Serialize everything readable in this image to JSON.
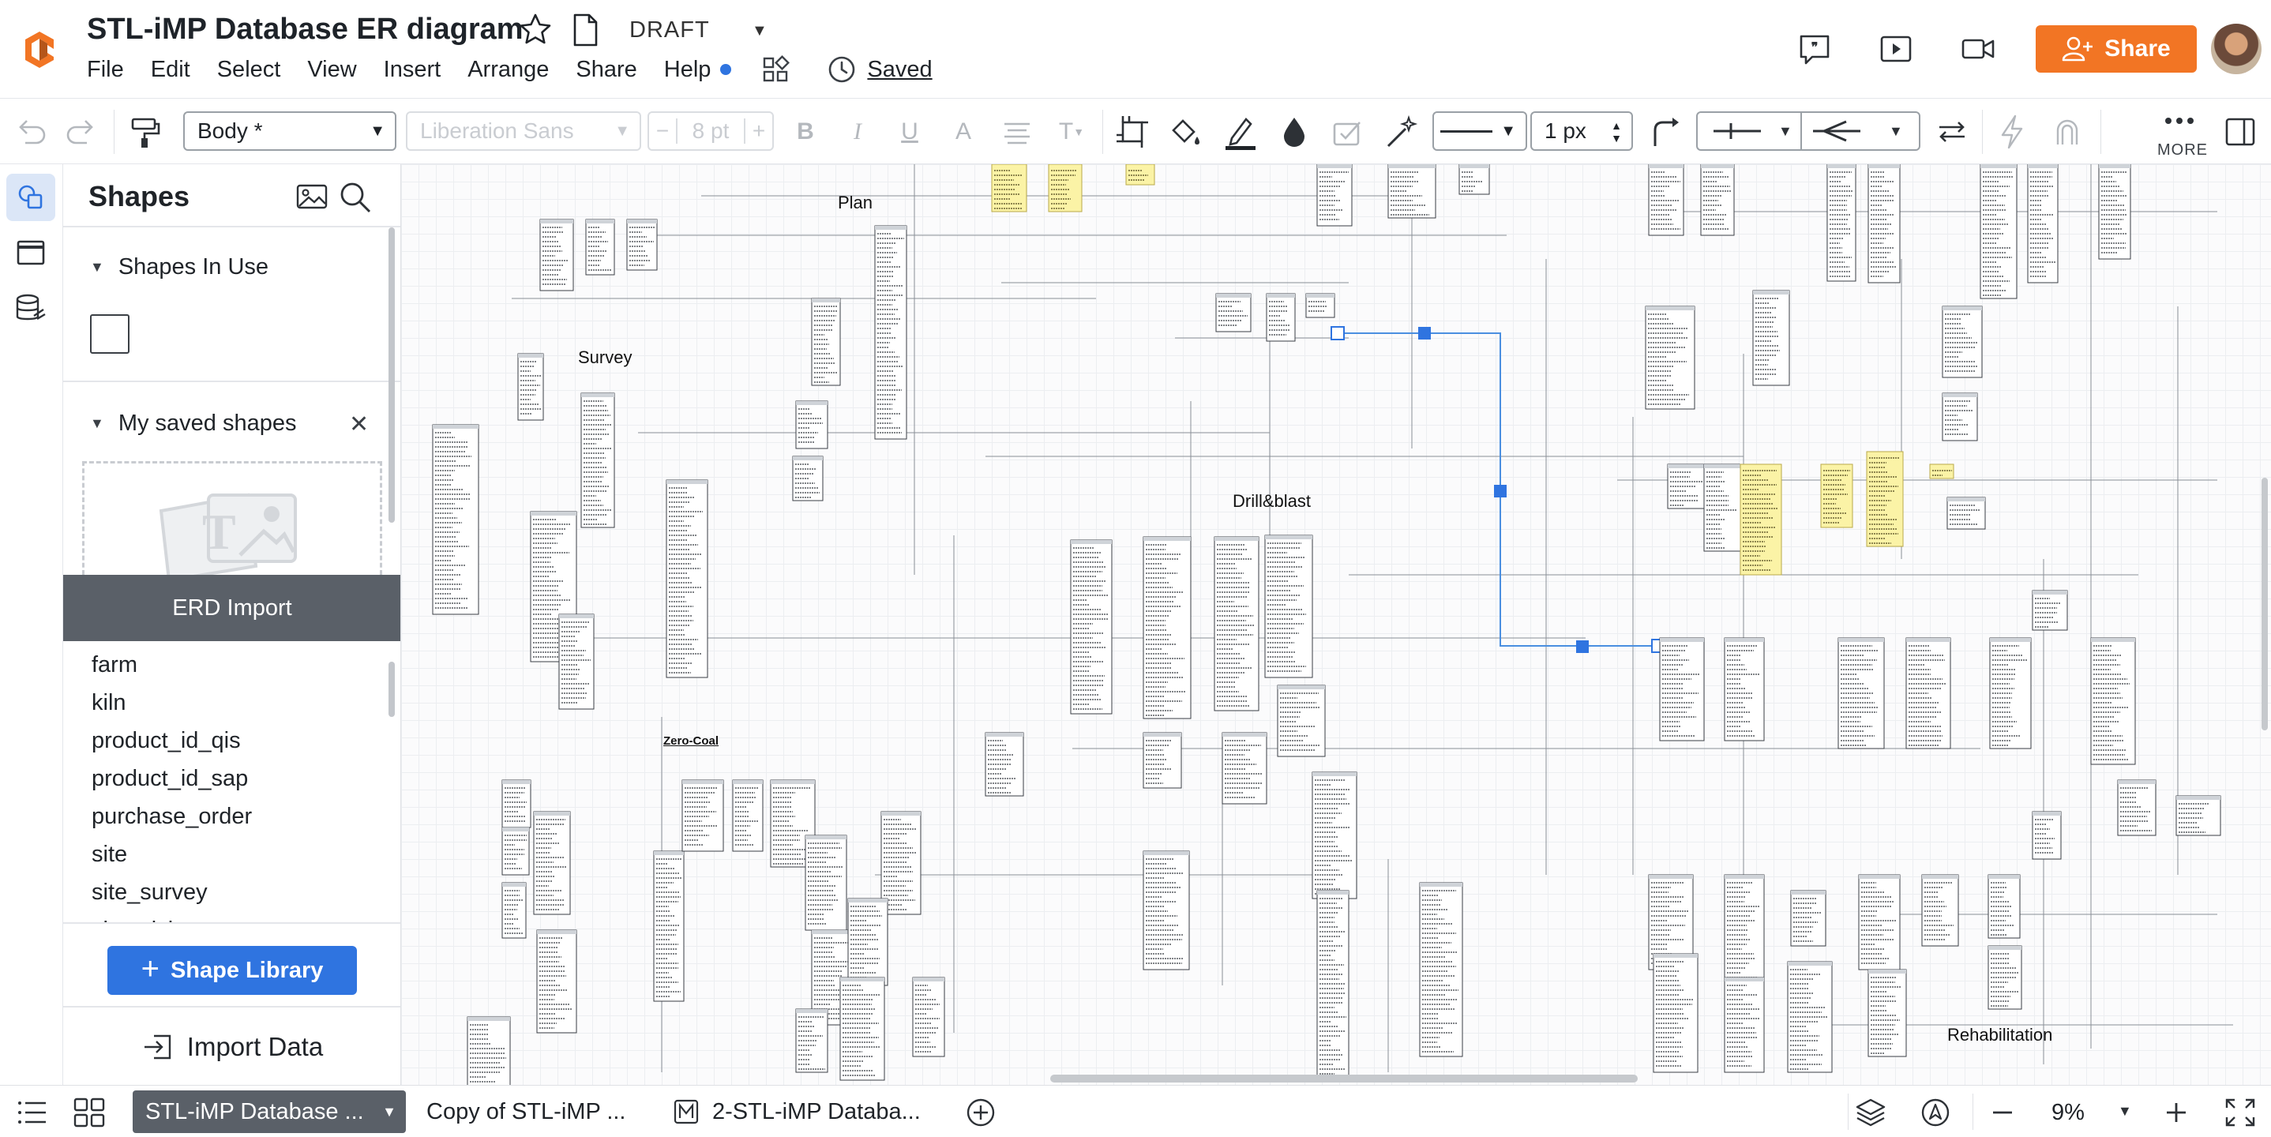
{
  "header": {
    "title": "STL-iMP Database ER diagram",
    "status": "DRAFT",
    "saved_label": "Saved",
    "share_label": "Share",
    "menu": [
      "File",
      "Edit",
      "Select",
      "View",
      "Insert",
      "Arrange",
      "Share",
      "Help"
    ],
    "accent_color": "#f27524"
  },
  "toolbar": {
    "style_value": "Body *",
    "font_value": "Liberation Sans",
    "font_size_value": "8 pt",
    "line_width_value": "1 px",
    "more_label": "MORE"
  },
  "panel": {
    "title": "Shapes",
    "sections": {
      "in_use": "Shapes In Use",
      "saved": "My saved shapes",
      "erd": "ERD Import"
    },
    "erd_items": [
      "farm",
      "kiln",
      "product_id_qis",
      "product_id_sap",
      "purchase_order",
      "site",
      "site_survey",
      "site_visit"
    ],
    "shape_library_label": "Shape Library",
    "import_data_label": "Import Data"
  },
  "canvas": {
    "group_labels": [
      "Plan",
      "Survey",
      "Drill&blast",
      "Zero-Coal",
      "Rehabilitation"
    ]
  },
  "bottom": {
    "pages": [
      "STL-iMP Database ...",
      "Copy of STL-iMP ...",
      "2-STL-iMP Databa..."
    ],
    "zoom": "9%"
  },
  "icons": {
    "logo": "lucid-logo-icon",
    "comments": "comment-icon",
    "present": "play-icon",
    "video": "video-icon",
    "canvas_bg": "grid"
  }
}
